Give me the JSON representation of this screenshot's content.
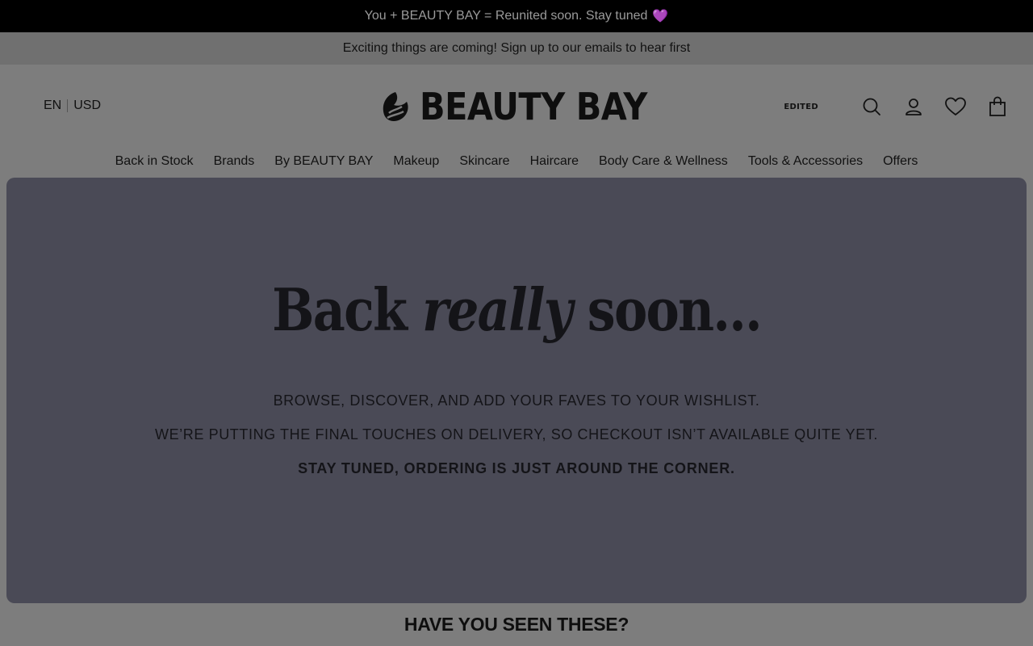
{
  "announcement": {
    "text": "You + BEAUTY BAY = Reunited soon. Stay tuned",
    "emoji": "💜",
    "emoji_color": "#7a2e8a"
  },
  "promo": {
    "text": "Exciting things are coming! Sign up to our emails to hear first"
  },
  "header": {
    "language": "EN",
    "currency": "USD",
    "logo_text": "BEAUTY BAY",
    "edited_label": "EDITED",
    "icons": [
      "search-icon",
      "account-icon",
      "wishlist-heart-icon",
      "bag-icon"
    ]
  },
  "nav": {
    "items": [
      {
        "label": "Back in Stock"
      },
      {
        "label": "Brands"
      },
      {
        "label": "By BEAUTY BAY"
      },
      {
        "label": "Makeup"
      },
      {
        "label": "Skincare"
      },
      {
        "label": "Haircare"
      },
      {
        "label": "Body Care & Wellness"
      },
      {
        "label": "Tools & Accessories"
      },
      {
        "label": "Offers"
      }
    ]
  },
  "hero": {
    "title_before": "Back",
    "title_emphasis": "really",
    "title_after": "soon...",
    "line1": "BROWSE, DISCOVER, AND ADD YOUR FAVES TO YOUR WISHLIST.",
    "line2": "WE’RE PUTTING THE FINAL TOUCHES ON DELIVERY, SO CHECKOUT ISN’T AVAILABLE QUITE YET.",
    "line3": "STAY TUNED, ORDERING IS JUST AROUND THE CORNER.",
    "background": "#4a4a56"
  },
  "section": {
    "heading": "HAVE YOU SEEN THESE?"
  },
  "colors": {
    "overlay": "#7d7d7d",
    "announcement_bg": "#000000",
    "text": "#111111"
  }
}
